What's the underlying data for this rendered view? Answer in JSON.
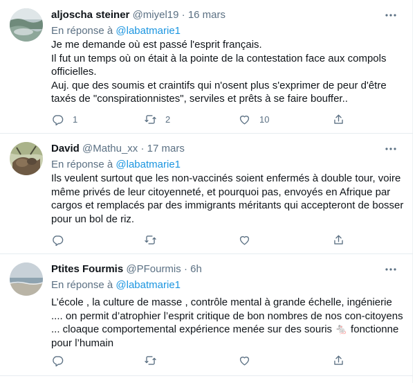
{
  "tweets": [
    {
      "name": "aljoscha steiner",
      "handle": "@miyel19",
      "sep": "·",
      "time": "16 mars",
      "reply_prefix": "En réponse à ",
      "reply_to": "@labatmarie1",
      "lines": [
        "Je me demande où est passé l'esprit français.",
        "Il fut un temps où on était à la pointe de la contestation face aux compols officielles.",
        "Auj. que des soumis et craintifs qui n'osent plus s'exprimer de peur d'être taxés de \"conspirationnistes\", serviles et prêts à se faire bouffer.."
      ],
      "replies": "1",
      "retweets": "2",
      "likes": "10"
    },
    {
      "name": "David",
      "handle": "@Mathu_xx",
      "sep": "·",
      "time": "17 mars",
      "reply_prefix": "En réponse à ",
      "reply_to": "@labatmarie1",
      "lines": [
        "Ils veulent surtout que les non-vaccinés soient enfermés à double tour, voire même privés de leur citoyenneté, et pourquoi pas, envoyés en Afrique par cargos et remplacés par des immigrants méritants qui accepteront de bosser pour un bol de riz."
      ],
      "replies": "",
      "retweets": "",
      "likes": ""
    },
    {
      "name": "Ptites Fourmis",
      "handle": "@PFourmis",
      "sep": "·",
      "time": "6h",
      "reply_prefix": "En réponse à ",
      "reply_to": "@labatmarie1",
      "lines": [
        "L’école , la culture de masse , contrôle mental à grande échelle, ingénierie .... on permit d’atrophier l’esprit critique de bon nombres de nos con-citoyens ... cloaque comportemental expérience menée sur des souris 🐁 fonctionne pour l’humain"
      ],
      "replies": "",
      "retweets": "",
      "likes": ""
    }
  ],
  "icons": {
    "reply": "reply-icon",
    "retweet": "retweet-icon",
    "like": "like-icon",
    "share": "share-icon",
    "more": "more-icon"
  },
  "colors": {
    "text": "#0f1419",
    "muted": "#5b7083",
    "link": "#1b95e0",
    "divider": "#e6ecf0"
  }
}
